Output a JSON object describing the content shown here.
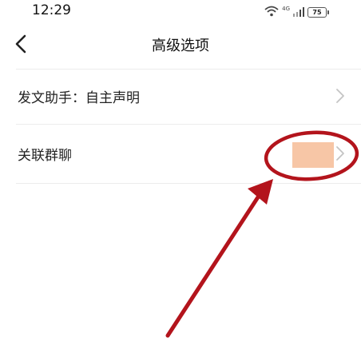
{
  "status_bar": {
    "time": "12:29",
    "network_label": "4G",
    "battery_level": "75"
  },
  "header": {
    "title": "高级选项"
  },
  "rows": [
    {
      "label": "发文助手：自主声明"
    },
    {
      "label": "关联群聊"
    }
  ],
  "colors": {
    "annotation_red": "#b3141c",
    "redaction_fill": "#f7c6a6"
  },
  "icons": {
    "back": "chevron-left-icon",
    "row_arrow": "chevron-right-icon"
  }
}
